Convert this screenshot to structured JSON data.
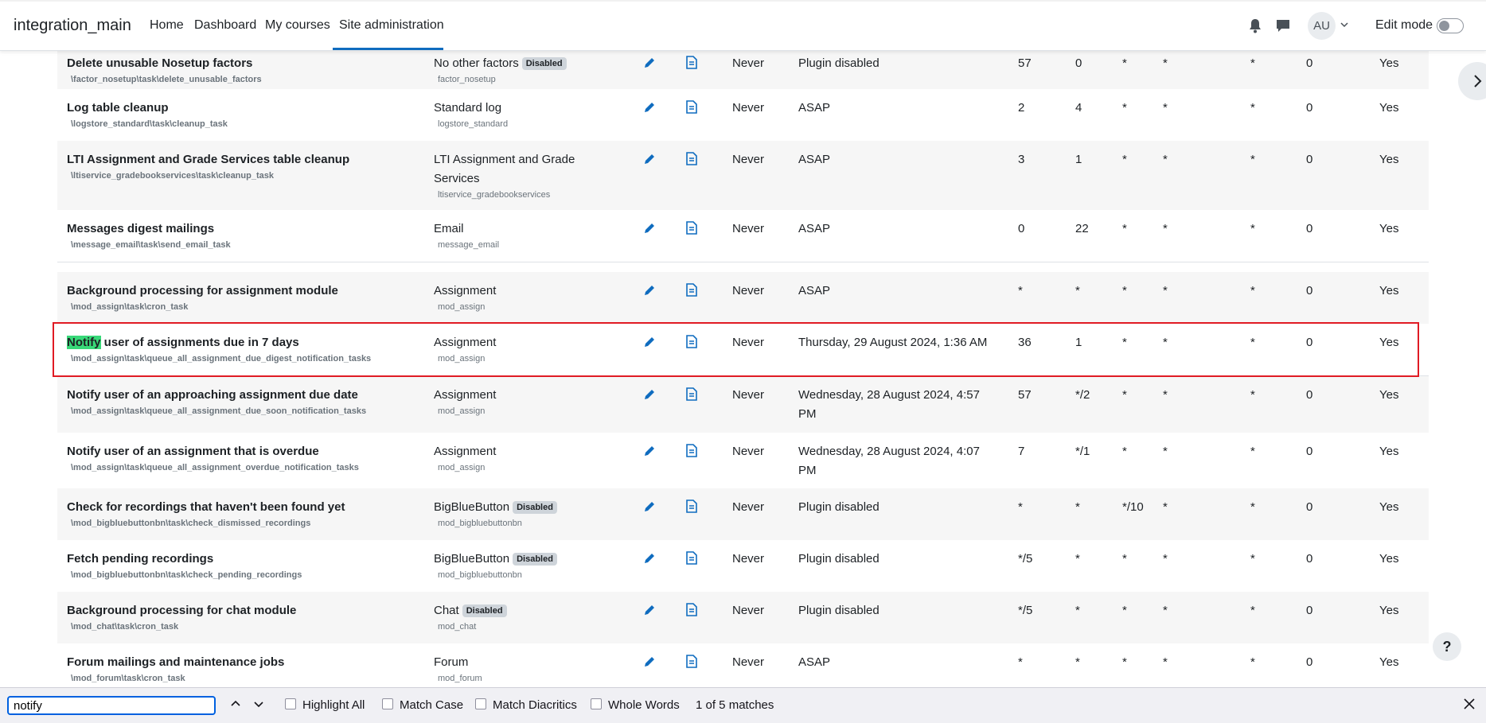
{
  "navbar": {
    "brand": "integration_main",
    "links": [
      "Home",
      "Dashboard",
      "My courses",
      "Site administration"
    ],
    "avatar": "AU",
    "edit_mode_label": "Edit mode"
  },
  "rows": [
    {
      "name": "Delete unusable Nosetup factors",
      "classname": "\\factor_nosetup\\task\\delete_unusable_factors",
      "component": "No other factors",
      "component_badge": "Disabled",
      "component_id": "factor_nosetup",
      "last_run": "Never",
      "next_run": "Plugin disabled",
      "minute": "57",
      "hour": "0",
      "day": "*",
      "dow": "*",
      "month": "*",
      "fail": "0",
      "default": "Yes"
    },
    {
      "name": "Log table cleanup",
      "classname": "\\logstore_standard\\task\\cleanup_task",
      "component": "Standard log",
      "component_badge": "",
      "component_id": "logstore_standard",
      "last_run": "Never",
      "next_run": "ASAP",
      "minute": "2",
      "hour": "4",
      "day": "*",
      "dow": "*",
      "month": "*",
      "fail": "0",
      "default": "Yes"
    },
    {
      "name": "LTI Assignment and Grade Services table cleanup",
      "classname": "\\ltiservice_gradebookservices\\task\\cleanup_task",
      "component": "LTI Assignment and Grade Services",
      "component_badge": "",
      "component_id": "ltiservice_gradebookservices",
      "last_run": "Never",
      "next_run": "ASAP",
      "minute": "3",
      "hour": "1",
      "day": "*",
      "dow": "*",
      "month": "*",
      "fail": "0",
      "default": "Yes"
    },
    {
      "name": "Messages digest mailings",
      "classname": "\\message_email\\task\\send_email_task",
      "component": "Email",
      "component_badge": "",
      "component_id": "message_email",
      "last_run": "Never",
      "next_run": "ASAP",
      "minute": "0",
      "hour": "22",
      "day": "*",
      "dow": "*",
      "month": "*",
      "fail": "0",
      "default": "Yes"
    },
    {
      "name": "Background processing for assignment module",
      "classname": "\\mod_assign\\task\\cron_task",
      "component": "Assignment",
      "component_badge": "",
      "component_id": "mod_assign",
      "last_run": "Never",
      "next_run": "ASAP",
      "minute": "*",
      "hour": "*",
      "day": "*",
      "dow": "*",
      "month": "*",
      "fail": "0",
      "default": "Yes"
    },
    {
      "name_hl": "Notify",
      "name_rest": " user of assignments due in 7 days",
      "classname": "\\mod_assign\\task\\queue_all_assignment_due_digest_notification_tasks",
      "component": "Assignment",
      "component_badge": "",
      "component_id": "mod_assign",
      "last_run": "Never",
      "next_run": "Thursday, 29 August 2024, 1:36 AM",
      "minute": "36",
      "hour": "1",
      "day": "*",
      "dow": "*",
      "month": "*",
      "fail": "0",
      "default": "Yes"
    },
    {
      "name": "Notify user of an approaching assignment due date",
      "classname": "\\mod_assign\\task\\queue_all_assignment_due_soon_notification_tasks",
      "component": "Assignment",
      "component_badge": "",
      "component_id": "mod_assign",
      "last_run": "Never",
      "next_run": "Wednesday, 28 August 2024, 4:57 PM",
      "minute": "57",
      "hour": "*/2",
      "day": "*",
      "dow": "*",
      "month": "*",
      "fail": "0",
      "default": "Yes"
    },
    {
      "name": "Notify user of an assignment that is overdue",
      "classname": "\\mod_assign\\task\\queue_all_assignment_overdue_notification_tasks",
      "component": "Assignment",
      "component_badge": "",
      "component_id": "mod_assign",
      "last_run": "Never",
      "next_run": "Wednesday, 28 August 2024, 4:07 PM",
      "minute": "7",
      "hour": "*/1",
      "day": "*",
      "dow": "*",
      "month": "*",
      "fail": "0",
      "default": "Yes"
    },
    {
      "name": "Check for recordings that haven't been found yet",
      "classname": "\\mod_bigbluebuttonbn\\task\\check_dismissed_recordings",
      "component": "BigBlueButton",
      "component_badge": "Disabled",
      "component_id": "mod_bigbluebuttonbn",
      "last_run": "Never",
      "next_run": "Plugin disabled",
      "minute": "*",
      "hour": "*",
      "day": "*/10",
      "dow": "*",
      "month": "*",
      "fail": "0",
      "default": "Yes"
    },
    {
      "name": "Fetch pending recordings",
      "classname": "\\mod_bigbluebuttonbn\\task\\check_pending_recordings",
      "component": "BigBlueButton",
      "component_badge": "Disabled",
      "component_id": "mod_bigbluebuttonbn",
      "last_run": "Never",
      "next_run": "Plugin disabled",
      "minute": "*/5",
      "hour": "*",
      "day": "*",
      "dow": "*",
      "month": "*",
      "fail": "0",
      "default": "Yes"
    },
    {
      "name": "Background processing for chat module",
      "classname": "\\mod_chat\\task\\cron_task",
      "component": "Chat",
      "component_badge": "Disabled",
      "component_id": "mod_chat",
      "last_run": "Never",
      "next_run": "Plugin disabled",
      "minute": "*/5",
      "hour": "*",
      "day": "*",
      "dow": "*",
      "month": "*",
      "fail": "0",
      "default": "Yes"
    },
    {
      "name": "Forum mailings and maintenance jobs",
      "classname": "\\mod_forum\\task\\cron_task",
      "component": "Forum",
      "component_badge": "",
      "component_id": "mod_forum",
      "last_run": "Never",
      "next_run": "ASAP",
      "minute": "*",
      "hour": "*",
      "day": "*",
      "dow": "*",
      "month": "*",
      "fail": "0",
      "default": "Yes"
    }
  ],
  "help_button": "?",
  "findbar": {
    "query": "notify",
    "highlight_all": "Highlight All",
    "match_case": "Match Case",
    "match_diacritics": "Match Diacritics",
    "whole_words": "Whole Words",
    "status": "1 of 5 matches"
  },
  "colors": {
    "accent": "#0f6cbf",
    "highlight": "#38d878",
    "focus_box": "#e01b24"
  }
}
